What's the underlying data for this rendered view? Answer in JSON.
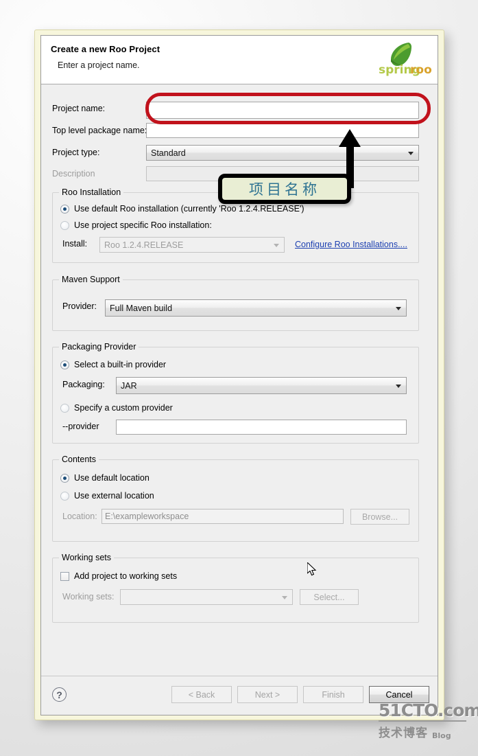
{
  "dialog": {
    "title": "Create a new Roo Project",
    "subtitle": "Enter a project name.",
    "logo_alt": "springroo-logo",
    "logo_text_light": "spring",
    "logo_text_bold": "roo"
  },
  "fields": {
    "project_name_label": "Project name:",
    "project_name_value": "",
    "top_level_package_label": "Top level package name:",
    "top_level_package_value": "",
    "project_type_label": "Project type:",
    "project_type_value": "Standard",
    "description_label": "Description",
    "description_value": ""
  },
  "roo_installation": {
    "group_title": "Roo Installation",
    "radio_default": "Use default Roo installation (currently 'Roo 1.2.4.RELEASE')",
    "radio_specific": "Use project specific Roo installation:",
    "install_label": "Install:",
    "install_value": "Roo 1.2.4.RELEASE",
    "configure_link": "Configure Roo Installations...."
  },
  "maven_support": {
    "group_title": "Maven Support",
    "provider_label": "Provider:",
    "provider_value": "Full Maven build"
  },
  "packaging_provider": {
    "group_title": "Packaging Provider",
    "radio_builtin": "Select a built-in provider",
    "packaging_label": "Packaging:",
    "packaging_value": "JAR",
    "radio_custom": "Specify a custom provider",
    "provider_label": "--provider",
    "provider_value": ""
  },
  "contents": {
    "group_title": "Contents",
    "radio_default": "Use default location",
    "radio_external": "Use external location",
    "location_label": "Location:",
    "location_value": "E:\\exampleworkspace",
    "browse_label": "Browse..."
  },
  "working_sets": {
    "group_title": "Working sets",
    "checkbox_label": "Add project to working sets",
    "sets_label": "Working sets:",
    "sets_value": "",
    "select_label": "Select..."
  },
  "footer": {
    "help_icon": "?",
    "back_label": "< Back",
    "next_label": "Next >",
    "finish_label": "Finish",
    "cancel_label": "Cancel"
  },
  "annotation": {
    "callout_text": "项目名称",
    "callout_color": "#2e7392",
    "callout_bg": "#e9eed4",
    "highlight_color": "#c1121c"
  },
  "watermark": {
    "main": "51CTO.com",
    "cn": "技术博客",
    "blog": "Blog"
  }
}
